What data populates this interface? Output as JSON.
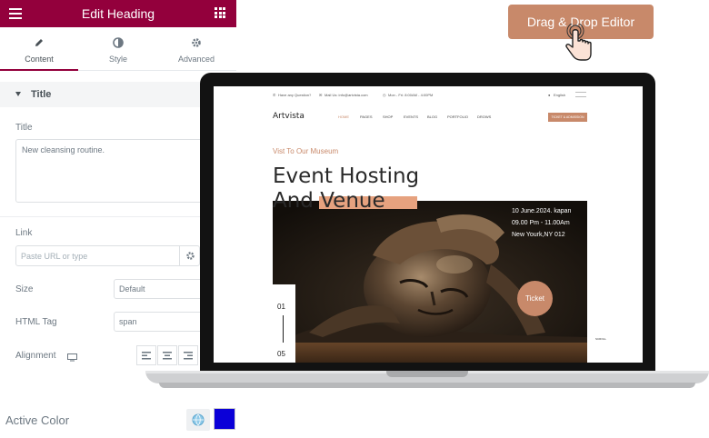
{
  "panel": {
    "header_title": "Edit Heading",
    "tabs": [
      {
        "label": "Content",
        "icon": "pencil-icon"
      },
      {
        "label": "Style",
        "icon": "half-circle-icon"
      },
      {
        "label": "Advanced",
        "icon": "gear-icon"
      }
    ],
    "section_title": "Title",
    "title_label": "Title",
    "title_value": "New cleansing routine.",
    "link_label": "Link",
    "link_placeholder": "Paste URL or type",
    "size_label": "Size",
    "size_value": "Default",
    "html_tag_label": "HTML Tag",
    "html_tag_value": "span",
    "alignment_label": "Alignment",
    "active_color_label": "Active Color",
    "active_color_value": "#0b00d8",
    "accent_color": "#93003c"
  },
  "badge": {
    "label": "Drag & Drop Editor",
    "color": "#c8896a"
  },
  "site": {
    "topbar": {
      "question": "Have any Question?",
      "mail": "Mail Us: info@artvista.com",
      "hours": "Mon - Fri: 8:00AM - 4:00PM",
      "language": "English"
    },
    "logo": "Artvista",
    "nav": [
      "HOME",
      "PAGES",
      "SHOP",
      "EVENTS",
      "BLOG",
      "PORTFOLIO",
      "DROWS"
    ],
    "cta": "TICKET & ADMISSION",
    "kicker": "Vist To Our Museum",
    "headline_line1": "Event Hosting",
    "headline_line2": "And Venue",
    "event_date": "10 June.2024. kapan",
    "event_time": "09.00 Pm - 11.00Am",
    "event_place": "New Yourk,NY 012",
    "ticket": "Ticket",
    "slide_first": "01",
    "slide_last": "05",
    "side_label": "SCROLL",
    "accent": "#c8896a"
  }
}
